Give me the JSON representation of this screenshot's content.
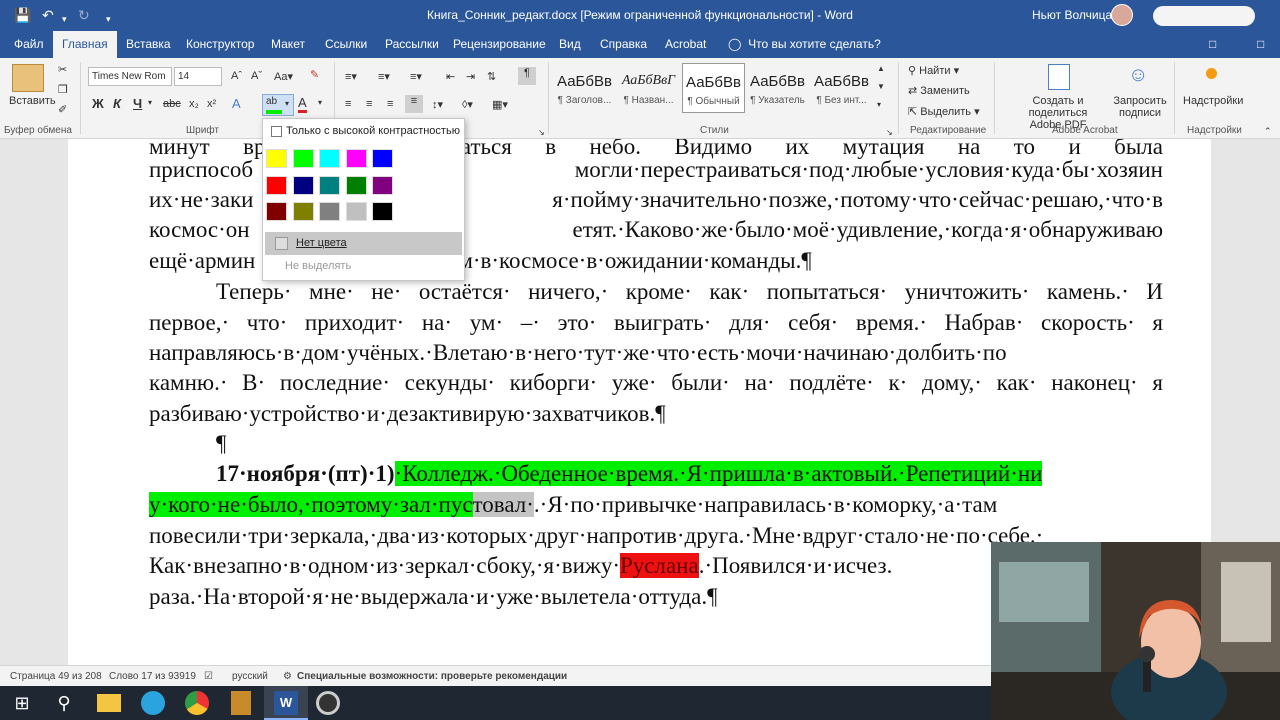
{
  "window": {
    "title": "Книга_Сонник_редакт.docx [Режим ограниченной функциональности]  -  Word",
    "user": "Ньют Волчица",
    "quick_access": [
      "save-icon",
      "undo-icon",
      "redo-icon",
      "customize-icon"
    ]
  },
  "tabs": [
    "Файл",
    "Главная",
    "Вставка",
    "Конструктор",
    "Макет",
    "Ссылки",
    "Рассылки",
    "Рецензирование",
    "Вид",
    "Справка",
    "Acrobat"
  ],
  "active_tab": "Главная",
  "tell_me": "Что вы хотите сделать?",
  "ribbon": {
    "clipboard": {
      "paste": "Вставить",
      "label": "Буфер обмена"
    },
    "font": {
      "name": "Times New Rom",
      "size": "14",
      "label": "Шрифт",
      "bold": "Ж",
      "italic": "К",
      "underline": "Ч"
    },
    "paragraph_label": "",
    "styles": {
      "items": [
        {
          "sample": "АаБбВв",
          "name": "¶ Заголов..."
        },
        {
          "sample": "АаБбВвГ",
          "name": "¶ Назван..."
        },
        {
          "sample": "АаБбВв",
          "name": "¶ Обычный"
        },
        {
          "sample": "АаБбВв",
          "name": "¶ Указатель"
        },
        {
          "sample": "АаБбВв",
          "name": "¶ Без инт..."
        }
      ],
      "label": "Стили"
    },
    "editing": {
      "find": "Найти",
      "replace": "Заменить",
      "select": "Выделить",
      "label": "Редактирование"
    },
    "acrobat": {
      "create": "Создать и поделиться",
      "create2": "Adobe PDF",
      "request": "Запросить",
      "request2": "подписи",
      "label": "Adobe Acrobat"
    },
    "settings": {
      "button": "Надстройки",
      "label": "Надстройки"
    }
  },
  "highlight_menu": {
    "high_contrast": "Только с высокой контрастностью",
    "colors": [
      "#ffff00",
      "#00ff00",
      "#00ffff",
      "#ff00ff",
      "#0000ff",
      "#ff0000",
      "#000080",
      "#008080",
      "#008000",
      "#800080",
      "#800000",
      "#808000",
      "#808080",
      "#c0c0c0",
      "#000000"
    ],
    "no_color": "Нет цвета",
    "stop": "Не выделять"
  },
  "document": {
    "lines": [
      {
        "text": "минут вра                    тали подниматься в небо. Видимо их мутация на то и была"
      },
      {
        "text": "приспособ                    могли·перестраиваться·под·любые·условия·куда·бы·хозяин"
      },
      {
        "text": "их·не·заки                   я·пойму·значительно·позже,·потому·что·сейчас·решаю,·что·в"
      },
      {
        "text": "космос·он                    етят.·Каково·же·было·моё·удивление,·когда·я·обнаруживаю"
      },
      {
        "text": "ещё·армин                   сших·ровным·строем·в·космосе·в·ожидании·команды.¶"
      },
      {
        "text": "Теперь· мне· не· остаётся· ничего,· кроме· как· попытаться· уничтожить· камень.· И"
      },
      {
        "text": "первое,· что· приходит· на· ум· –· это· выиграть· для· себя· время.· Набрав· скорость· я"
      },
      {
        "text": "направляюсь·в·дом·учёных.·Влетаю·в·него·тут·же·что·есть·мочи·начинаю·долбить·по"
      },
      {
        "text": "камню.· В· последние· секунды· киборги· уже· были· на· подлёте· к· дому,· как· наконец· я"
      },
      {
        "text": "разбиваю·устройство·и·дезактивирую·захватчиков.¶"
      },
      {
        "text": "¶"
      },
      {
        "bold": "17·ноября·(пт)·1)",
        "green": "·Колледж.·Обеденное·время.·Я·пришла·в·актовый.·Репетиций·ни"
      },
      {
        "green": "у·кого·не·было,·поэтому·зал·пус",
        "gray": "товал·",
        "rest": ".·Я·по·привычке·направилась·в·коморку,·а·там"
      },
      {
        "text": "повесили·три·зеркала,·два·из·которых·друг·напротив·друга.·Мне·вдруг·стало·не·по·себе.·"
      },
      {
        "pre": "Как·внезапно·в·одном·из·зеркал·сбоку,·я·вижу·",
        "red": "Руслана",
        "post": ".·Появился·и·исчез."
      },
      {
        "text": "раза.·На·второй·я·не·выдержала·и·уже·вылетела·оттуда.¶"
      }
    ]
  },
  "status": {
    "page": "Страница 49 из 208",
    "words": "Слово 17 из 93919",
    "lang": "русский",
    "accessibility": "Специальные возможности: проверьте рекомендации"
  },
  "taskbar": [
    "windows-icon",
    "search-icon",
    "file-explorer-icon",
    "telegram-icon",
    "chrome-icon",
    "media-icon",
    "word-icon",
    "obs-icon"
  ]
}
